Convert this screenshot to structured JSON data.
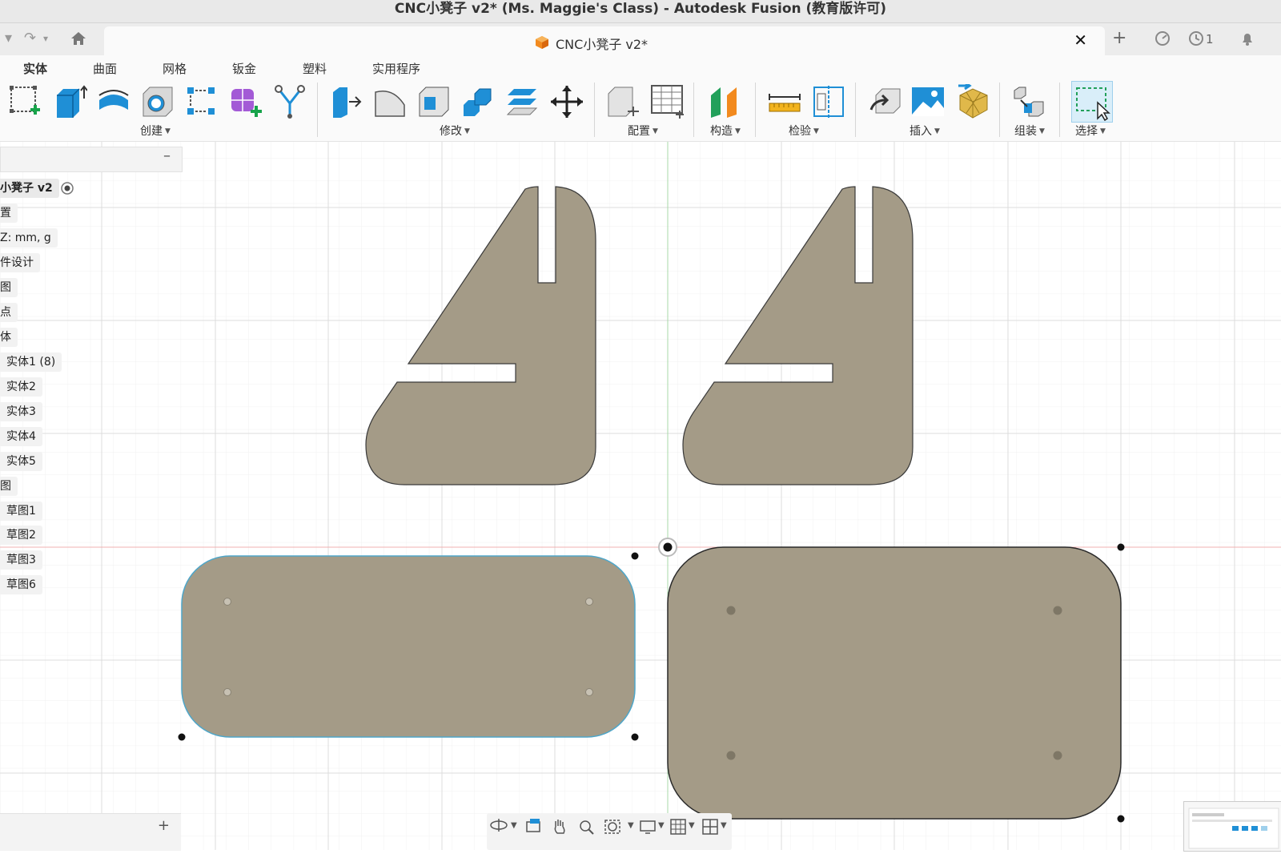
{
  "window": {
    "title": "CNC小凳子 v2* (Ms. Maggie's Class) - Autodesk Fusion (教育版许可)"
  },
  "doc_tab": {
    "title": "CNC小凳子 v2*",
    "close": "✕"
  },
  "top_right": {
    "plus": "+",
    "job_count": "1"
  },
  "ribbon_tabs": [
    "实体",
    "曲面",
    "网格",
    "钣金",
    "塑料",
    "实用程序"
  ],
  "tool_groups": {
    "create": "创建",
    "modify": "修改",
    "configure": "配置",
    "construct": "构造",
    "inspect": "检验",
    "insert": "插入",
    "assemble": "组装",
    "select": "选择"
  },
  "browser": {
    "collapse": "–",
    "add": "+",
    "items": [
      {
        "label": "小凳子 v2",
        "root": true
      },
      {
        "label": "置"
      },
      {
        "label": "Z: mm, g"
      },
      {
        "label": "件设计"
      },
      {
        "label": "图"
      },
      {
        "label": "点"
      },
      {
        "label": "体"
      },
      {
        "label": "实体1 (8)"
      },
      {
        "label": "实体2"
      },
      {
        "label": "实体3"
      },
      {
        "label": "实体4"
      },
      {
        "label": "实体5"
      },
      {
        "label": "图"
      },
      {
        "label": "草图1"
      },
      {
        "label": "草图2"
      },
      {
        "label": "草图3"
      },
      {
        "label": "草图6"
      }
    ]
  },
  "colors": {
    "part_fill": "#a49b87",
    "part_stroke": "#3a3a3a",
    "selected_stroke": "#4ea6c9",
    "grid_minor": "#f1f1f1",
    "grid_major": "#dcdcdc",
    "axis_green": "#a8d8a8",
    "axis_red": "#f0b0b0",
    "accent_blue": "#1f8fd6"
  }
}
